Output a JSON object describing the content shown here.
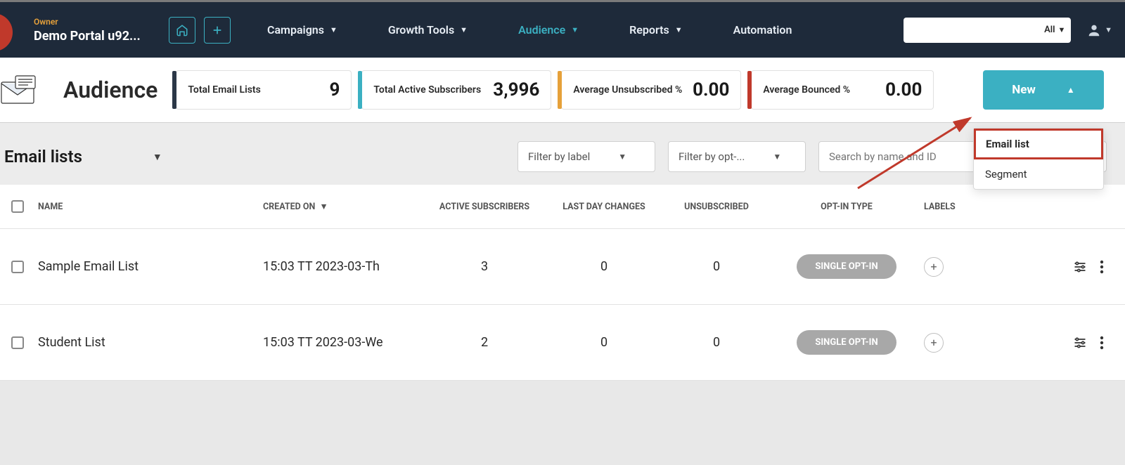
{
  "owner": {
    "label": "Owner",
    "name": "Demo Portal u92..."
  },
  "nav": {
    "campaigns": "Campaigns",
    "growth": "Growth Tools",
    "audience": "Audience",
    "reports": "Reports",
    "automation": "Automation"
  },
  "search": {
    "all": "All"
  },
  "page": {
    "title": "Audience"
  },
  "stats": [
    {
      "label": "Total Email Lists",
      "value": "9",
      "color": "#2b3747"
    },
    {
      "label": "Total Active Subscribers",
      "value": "3,996",
      "color": "#3bb0c2"
    },
    {
      "label": "Average Unsubscribed %",
      "value": "0.00",
      "color": "#e6a13a"
    },
    {
      "label": "Average Bounced %",
      "value": "0.00",
      "color": "#c0392b"
    }
  ],
  "newBtn": {
    "label": "New"
  },
  "newMenu": {
    "emailList": "Email list",
    "segment": "Segment"
  },
  "section": {
    "title": "Email lists",
    "filterLabel": "Filter by label",
    "filterOpt": "Filter by opt-...",
    "searchPh": "Search by name and ID"
  },
  "columns": {
    "name": "NAME",
    "created": "CREATED ON",
    "active": "ACTIVE SUBSCRIBERS",
    "lastday": "LAST DAY CHANGES",
    "unsub": "UNSUBSCRIBED",
    "optin": "OPT-IN TYPE",
    "labels": "LABELS"
  },
  "rows": [
    {
      "name": "Sample Email List",
      "created": "15:03 TT 2023-03-Th",
      "active": "3",
      "lastday": "0",
      "unsub": "0",
      "optin": "SINGLE OPT-IN"
    },
    {
      "name": "Student List",
      "created": "15:03 TT 2023-03-We",
      "active": "2",
      "lastday": "0",
      "unsub": "0",
      "optin": "SINGLE OPT-IN"
    }
  ]
}
